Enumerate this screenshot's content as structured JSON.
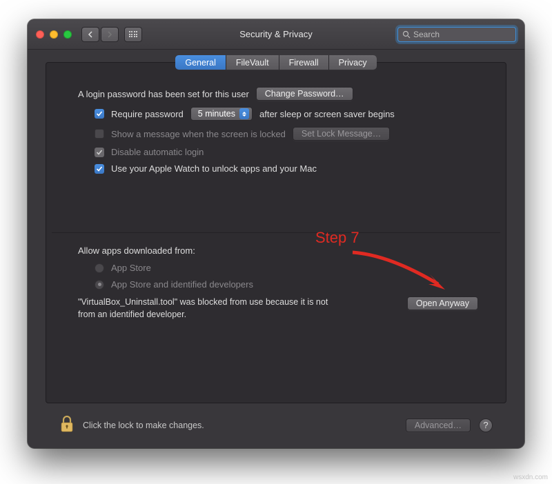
{
  "window": {
    "title": "Security & Privacy",
    "search_placeholder": "Search"
  },
  "tabs": [
    {
      "label": "General",
      "selected": true
    },
    {
      "label": "FileVault",
      "selected": false
    },
    {
      "label": "Firewall",
      "selected": false
    },
    {
      "label": "Privacy",
      "selected": false
    }
  ],
  "login": {
    "set_text": "A login password has been set for this user",
    "change_password_btn": "Change Password…",
    "require_password_label": "Require password",
    "require_password_delay": "5 minutes",
    "after_sleep_text": "after sleep or screen saver begins",
    "show_message_label": "Show a message when the screen is locked",
    "set_lock_message_btn": "Set Lock Message…",
    "disable_auto_login_label": "Disable automatic login",
    "apple_watch_label": "Use your Apple Watch to unlock apps and your Mac"
  },
  "gatekeeper": {
    "heading": "Allow apps downloaded from:",
    "option_app_store": "App Store",
    "option_identified": "App Store and identified developers",
    "blocked_text": "\"VirtualBox_Uninstall.tool\" was blocked from use because it is not from an identified developer.",
    "open_anyway_btn": "Open Anyway"
  },
  "footer": {
    "lock_text": "Click the lock to make changes.",
    "advanced_btn": "Advanced…",
    "help": "?"
  },
  "annotation": {
    "text": "Step 7"
  },
  "watermark": "wsxdn.com"
}
